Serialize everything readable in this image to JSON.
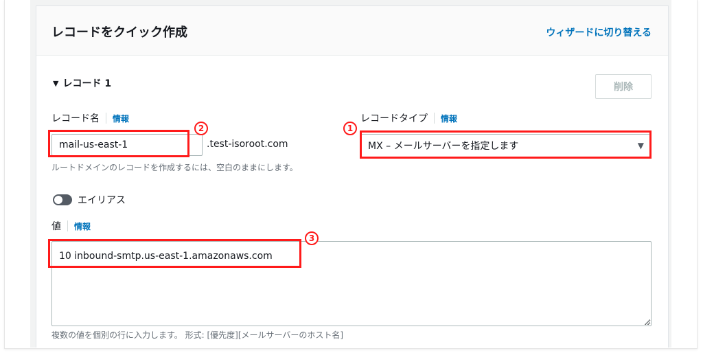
{
  "header": {
    "title": "レコードをクイック作成",
    "wizard_link": "ウィザードに切り替える"
  },
  "record": {
    "heading": "レコード 1",
    "delete_button": "削除",
    "name_label": "レコード名",
    "info_label": "情報",
    "name_value": "mail-us-east-1",
    "domain_suffix": ".test-isoroot.com",
    "name_hint": "ルートドメインのレコードを作成するには、空白のままにします。",
    "type_label": "レコードタイプ",
    "type_value": "MX – メールサーバーを指定します",
    "alias_label": "エイリアス",
    "value_label": "値",
    "value_text": "10 inbound-smtp.us-east-1.amazonaws.com",
    "value_hint": "複数の値を個別の行に入力します。 形式: [優先度][メールサーバーのホスト名]"
  },
  "annotations": {
    "badge_1": "1",
    "badge_2": "2",
    "badge_3": "3",
    "highlight_color": "#ff1a1a"
  },
  "colors": {
    "link": "#0073bb",
    "text": "#16191f",
    "muted": "#687078"
  },
  "icons": {
    "collapse": "triangle-down-icon",
    "select_caret": "chevron-down-icon",
    "toggle": "toggle-off-icon",
    "resize": "resize-grip-icon"
  }
}
